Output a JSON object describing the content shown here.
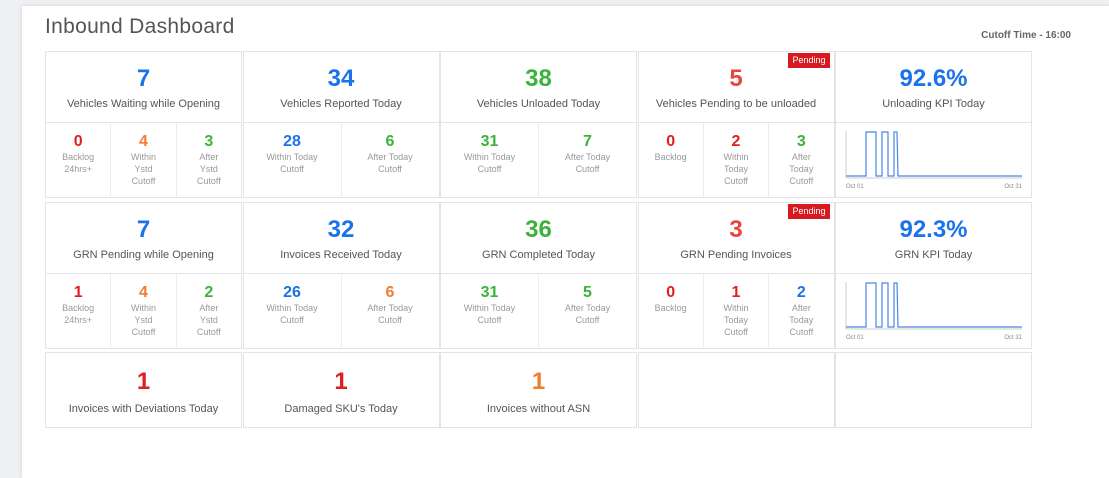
{
  "header": {
    "title": "Inbound Dashboard",
    "cutoff": "Cutoff Time - 16:00"
  },
  "colors": {
    "blue": "#1a73e8",
    "green": "#3bb33b",
    "orange": "#f07c2e",
    "red": "#e02020",
    "pending_badge": "#d71920"
  },
  "pending_label": "Pending",
  "row1": [
    {
      "value": "7",
      "label": "Vehicles Waiting while Opening",
      "color": "blue",
      "subs": [
        {
          "value": "0",
          "lines": [
            "Backlog",
            "24hrs+"
          ],
          "color": "red"
        },
        {
          "value": "4",
          "lines": [
            "Within",
            "Ystd",
            "Cutoff"
          ],
          "color": "orange"
        },
        {
          "value": "3",
          "lines": [
            "After",
            "Ystd",
            "Cutoff"
          ],
          "color": "green"
        }
      ]
    },
    {
      "value": "34",
      "label": "Vehicles Reported Today",
      "color": "blue",
      "subs": [
        {
          "value": "28",
          "lines": [
            "Within Today",
            "Cutoff"
          ],
          "color": "blue"
        },
        {
          "value": "6",
          "lines": [
            "After Today",
            "Cutoff"
          ],
          "color": "green"
        }
      ]
    },
    {
      "value": "38",
      "label": "Vehicles Unloaded Today",
      "color": "green",
      "subs": [
        {
          "value": "31",
          "lines": [
            "Within Today",
            "Cutoff"
          ],
          "color": "green"
        },
        {
          "value": "7",
          "lines": [
            "After Today",
            "Cutoff"
          ],
          "color": "green"
        }
      ]
    },
    {
      "value": "5",
      "label": "Vehicles Pending to be unloaded",
      "color": "redo",
      "pending": true,
      "subs": [
        {
          "value": "0",
          "lines": [
            "Backlog"
          ],
          "color": "red"
        },
        {
          "value": "2",
          "lines": [
            "Within",
            "Today",
            "Cutoff"
          ],
          "color": "red"
        },
        {
          "value": "3",
          "lines": [
            "After",
            "Today",
            "Cutoff"
          ],
          "color": "green"
        }
      ]
    },
    {
      "value": "92.6%",
      "label": "Unloading KPI Today",
      "color": "blue",
      "spark": {
        "x_start": "Oct 01",
        "x_end": "Oct 31"
      }
    }
  ],
  "row2": [
    {
      "value": "7",
      "label": "GRN Pending while Opening",
      "color": "blue",
      "subs": [
        {
          "value": "1",
          "lines": [
            "Backlog",
            "24hrs+"
          ],
          "color": "red"
        },
        {
          "value": "4",
          "lines": [
            "Within",
            "Ystd",
            "Cutoff"
          ],
          "color": "orange"
        },
        {
          "value": "2",
          "lines": [
            "After",
            "Ystd",
            "Cutoff"
          ],
          "color": "green"
        }
      ]
    },
    {
      "value": "32",
      "label": "Invoices Received Today",
      "color": "blue",
      "subs": [
        {
          "value": "26",
          "lines": [
            "Within Today",
            "Cutoff"
          ],
          "color": "blue"
        },
        {
          "value": "6",
          "lines": [
            "After Today",
            "Cutoff"
          ],
          "color": "orange"
        }
      ]
    },
    {
      "value": "36",
      "label": "GRN Completed Today",
      "color": "green",
      "subs": [
        {
          "value": "31",
          "lines": [
            "Within Today",
            "Cutoff"
          ],
          "color": "green"
        },
        {
          "value": "5",
          "lines": [
            "After Today",
            "Cutoff"
          ],
          "color": "green"
        }
      ]
    },
    {
      "value": "3",
      "label": "GRN Pending Invoices",
      "color": "redo",
      "pending": true,
      "subs": [
        {
          "value": "0",
          "lines": [
            "Backlog"
          ],
          "color": "red"
        },
        {
          "value": "1",
          "lines": [
            "Within",
            "Today",
            "Cutoff"
          ],
          "color": "red"
        },
        {
          "value": "2",
          "lines": [
            "After",
            "Today",
            "Cutoff"
          ],
          "color": "blue"
        }
      ]
    },
    {
      "value": "92.3%",
      "label": "GRN KPI Today",
      "color": "blue",
      "spark": {
        "x_start": "Oct 01",
        "x_end": "Oct 31"
      }
    }
  ],
  "row3": [
    {
      "value": "1",
      "label": "Invoices with Deviations Today",
      "color": "red"
    },
    {
      "value": "1",
      "label": "Damaged SKU's Today",
      "color": "red"
    },
    {
      "value": "1",
      "label": "Invoices without ASN",
      "color": "orange"
    },
    {
      "value": "",
      "label": ""
    },
    {
      "value": "",
      "label": ""
    }
  ]
}
